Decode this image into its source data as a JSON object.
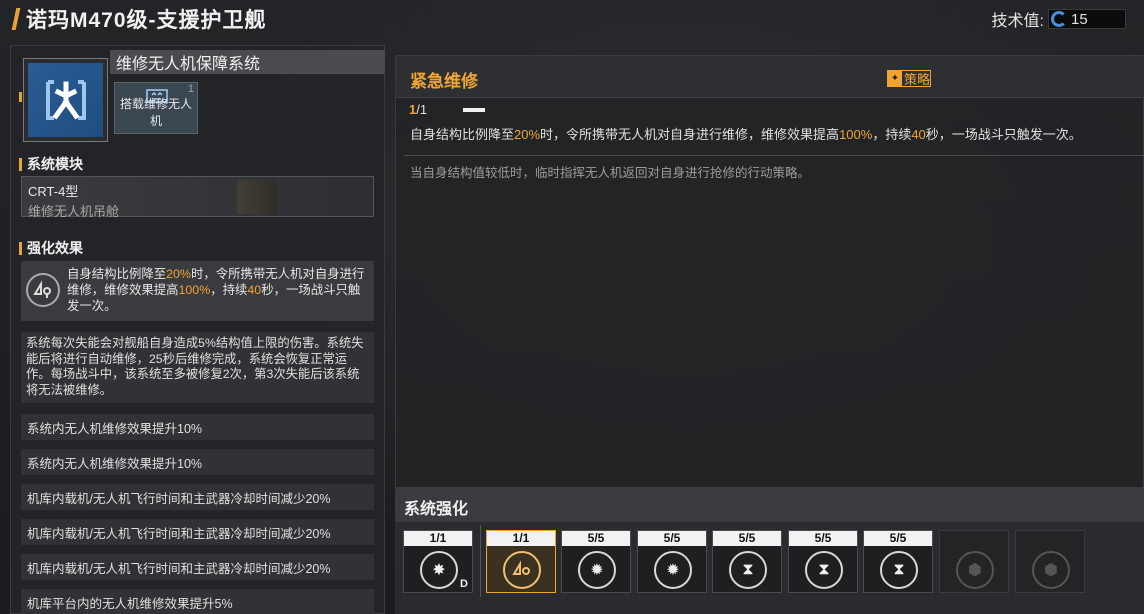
{
  "header": {
    "title": "诺玛M470级-支援护卫舰",
    "tech_label": "技术值:",
    "tech_value": "15"
  },
  "left_panel": {
    "system_name": "维修无人机保障系统",
    "sub_card": {
      "count": "1",
      "label": "搭载维修无人机"
    },
    "module_section_title": "系统模块",
    "module": {
      "model": "CRT-4型",
      "name": "维修无人机吊舱"
    },
    "effect_section_title": "强化效果",
    "effect_main": {
      "p1": "自身结构比例降至",
      "v1": "20%",
      "p2": "时，令所携带无人机对自身进行维修，维修效果提高",
      "v2": "100%",
      "p3": "，持续",
      "v3": "40",
      "p4": "秒，一场战斗只触发一次。"
    },
    "description": "系统每次失能会对舰船自身造成5%结构值上限的伤害。系统失能后将进行自动维修，25秒后维修完成，系统会恢复正常运作。每场战斗中，该系统至多被修复2次，第3次失能后该系统将无法被维修。",
    "upgrades": [
      "系统内无人机维修效果提升10%",
      "系统内无人机维修效果提升10%",
      "机库内载机/无人机飞行时间和主武器冷却时间减少20%",
      "机库内载机/无人机飞行时间和主武器冷却时间减少20%",
      "机库内载机/无人机飞行时间和主武器冷却时间减少20%",
      "机库平台内的无人机维修效果提升5%"
    ]
  },
  "right_panel": {
    "title": "紧急维修",
    "strategy_label": "策略",
    "count_current": "1",
    "count_total": "/1",
    "effect": {
      "p1": "自身结构比例降至",
      "v1": "20%",
      "p2": "时，令所携带无人机对自身进行维修，维修效果提高",
      "v2": "100%",
      "p3": "，持续",
      "v3": "40",
      "p4": "秒，一场战斗只触发一次。"
    },
    "flavor": "当自身结构值较低时，临时指挥无人机返回对自身进行抢修的行动策略。"
  },
  "system_upgrade": {
    "title": "系统强化",
    "slots": [
      {
        "count": "1/1",
        "icon": "burst-icon",
        "badge": "D"
      },
      {
        "count": "1/1",
        "icon": "repair-drone-icon",
        "selected": true
      },
      {
        "count": "5/5",
        "icon": "impact-icon"
      },
      {
        "count": "5/5",
        "icon": "impact-icon"
      },
      {
        "count": "5/5",
        "icon": "hourglass-icon"
      },
      {
        "count": "5/5",
        "icon": "hourglass-icon"
      },
      {
        "count": "5/5",
        "icon": "hourglass-icon"
      },
      {
        "count": "",
        "icon": "locked-icon",
        "locked": true
      },
      {
        "count": "",
        "icon": "locked-icon",
        "locked": true
      }
    ]
  }
}
